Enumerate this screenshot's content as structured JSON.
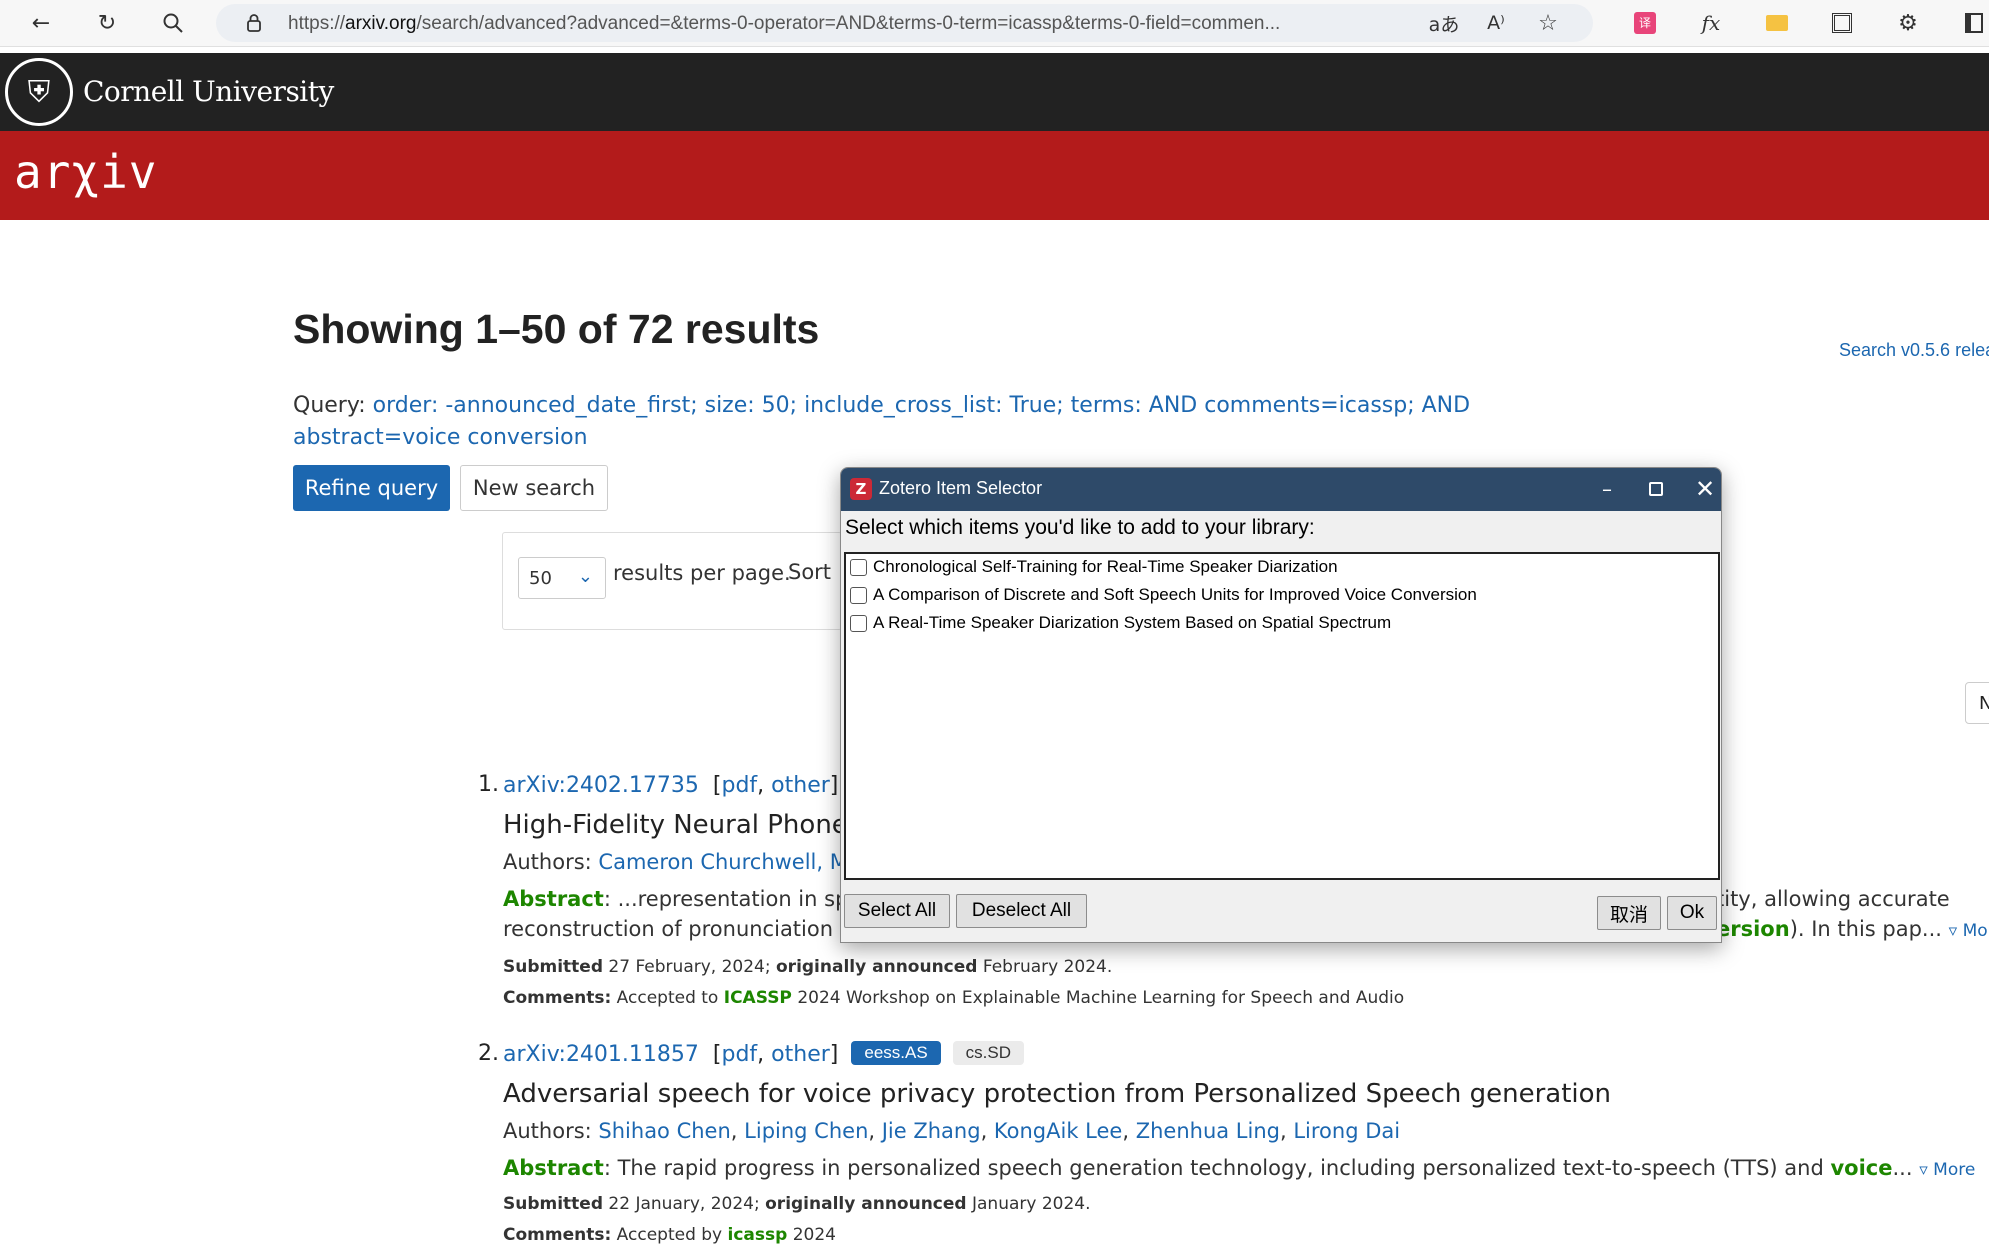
{
  "browser": {
    "url_prefix": "https://",
    "url_domain": "arxiv.org",
    "url_rest": "/search/advanced?advanced=&terms-0-operator=AND&terms-0-term=icassp&terms-0-field=commen..."
  },
  "header": {
    "university": "Cornell University",
    "logo": "arXiv"
  },
  "search": {
    "heading": "Showing 1–50 of 72 results",
    "version_link": "Search v0.5.6 relea",
    "query_label": "Query:",
    "query_text": "order: -announced_date_first; size: 50; include_cross_list: True; terms: AND comments=icassp; AND abstract=voice conversion",
    "refine_button": "Refine query",
    "new_search_button": "New search",
    "per_page_value": "50",
    "per_page_label": "results per page.",
    "sort_label": "Sort",
    "side_button": "N"
  },
  "results": [
    {
      "num": "1.",
      "id": "arXiv:2402.17735",
      "pdf": "pdf",
      "other": "other",
      "title": "High-Fidelity Neural Phone",
      "authors_label": "Authors:",
      "authors": "Cameron Churchwell, Ma",
      "abstract_label": "Abstract",
      "abstract_1a": ": ...representation in spee",
      "abstract_1b": "tity, allowing accurate",
      "abstract_2a": "reconstruction of pronunciation (e",
      "abstract_2hl": "ersion",
      "abstract_2b": "). In this pap...",
      "more": "▿ More",
      "submitted_label": "Submitted",
      "submitted": "27 February, 2024;",
      "announced_label": "originally announced",
      "announced": "February 2024.",
      "comments_label": "Comments:",
      "comments_a": "Accepted to",
      "comments_hl": "ICASSP",
      "comments_b": "2024 Workshop on Explainable Machine Learning for Speech and Audio"
    },
    {
      "num": "2.",
      "id": "arXiv:2401.11857",
      "pdf": "pdf",
      "other": "other",
      "tag_primary": "eess.AS",
      "tag_secondary": "cs.SD",
      "title": "Adversarial speech for voice privacy protection from Personalized Speech generation",
      "authors_label": "Authors:",
      "authors": [
        "Shihao Chen",
        "Liping Chen",
        "Jie Zhang",
        "KongAik Lee",
        "Zhenhua Ling",
        "Lirong Dai"
      ],
      "abstract_label": "Abstract",
      "abstract_a": ": The rapid progress in personalized speech generation technology, including personalized text-to-speech (TTS) and",
      "abstract_hl": "voice",
      "abstract_b": "...",
      "more": "▿ More",
      "submitted_label": "Submitted",
      "submitted": "22 January, 2024;",
      "announced_label": "originally announced",
      "announced": "January 2024.",
      "comments_label": "Comments:",
      "comments_a": "Accepted by",
      "comments_hl": "icassp",
      "comments_b": "2024"
    }
  ],
  "dialog": {
    "title": "Zotero Item Selector",
    "prompt": "Select which items you'd like to add to your library:",
    "items": [
      "Chronological Self-Training for Real-Time Speaker Diarization",
      "A Comparison of Discrete and Soft Speech Units for Improved Voice Conversion",
      "A Real-Time Speaker Diarization System Based on Spatial Spectrum"
    ],
    "select_all": "Select All",
    "deselect_all": "Deselect All",
    "cancel": "取消",
    "ok": "Ok"
  },
  "colors": {
    "arxiv_red": "#b31b1b",
    "link_blue": "#1c67b0",
    "highlight_green": "#1d8600",
    "dialog_title": "#2e4a69"
  }
}
